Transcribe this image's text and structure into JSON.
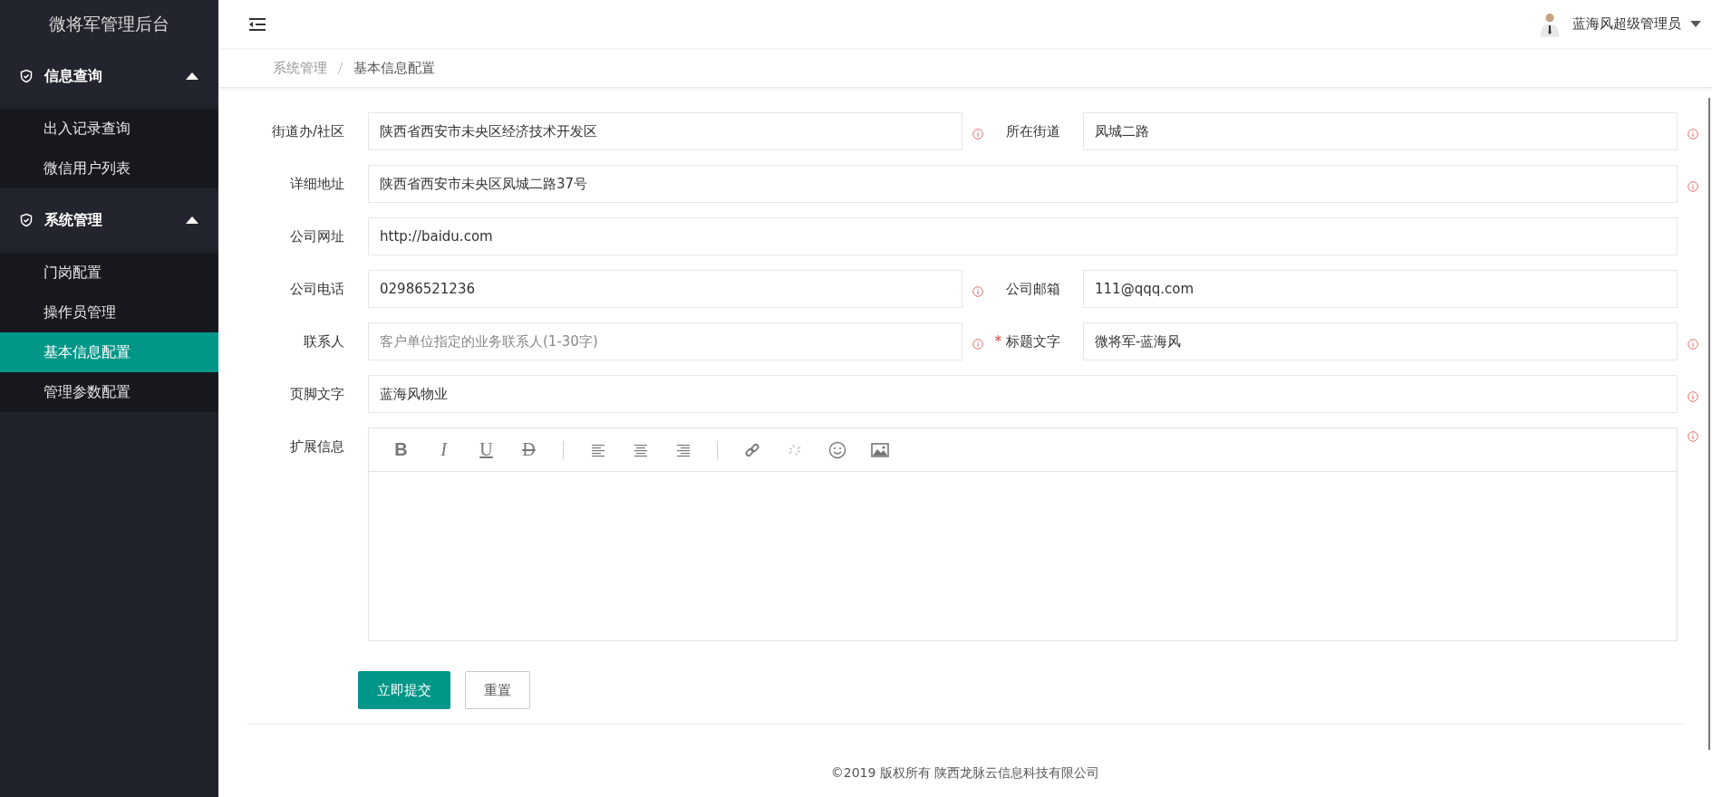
{
  "sidebar": {
    "title": "微将军管理后台",
    "groups": [
      {
        "label": "信息查询",
        "expanded": true,
        "items": [
          {
            "label": "出入记录查询",
            "selected": false
          },
          {
            "label": "微信用户列表",
            "selected": false
          }
        ]
      },
      {
        "label": "系统管理",
        "expanded": true,
        "items": [
          {
            "label": "门岗配置",
            "selected": false
          },
          {
            "label": "操作员管理",
            "selected": false
          },
          {
            "label": "基本信息配置",
            "selected": true
          },
          {
            "label": "管理参数配置",
            "selected": false
          }
        ]
      }
    ]
  },
  "header": {
    "user": "蓝海风超级管理员"
  },
  "breadcrumb": [
    "系统管理",
    "基本信息配置"
  ],
  "form": {
    "required_mark": "*",
    "rows": [
      {
        "fields": [
          {
            "label": "街道办/社区",
            "value": "陕西省西安市未央区经济技术开发区",
            "info": true,
            "required": false
          },
          {
            "label": "所在街道",
            "value": "凤城二路",
            "info": true,
            "required": false
          }
        ]
      },
      {
        "fields": [
          {
            "label": "详细地址",
            "value": "陕西省西安市未央区凤城二路37号",
            "info": true,
            "required": false
          }
        ]
      },
      {
        "fields": [
          {
            "label": "公司网址",
            "value": "http://baidu.com",
            "required": false
          }
        ]
      },
      {
        "fields": [
          {
            "label": "公司电话",
            "value": "02986521236",
            "info": true,
            "required": false
          },
          {
            "label": "公司邮箱",
            "value": "111@qqq.com",
            "required": false
          }
        ]
      },
      {
        "fields": [
          {
            "label": "联系人",
            "placeholder": "客户单位指定的业务联系人(1-30字)",
            "info": true,
            "required": false
          },
          {
            "label": "标题文字",
            "value": "微将军-蓝海风",
            "info": true,
            "required": true
          }
        ]
      },
      {
        "fields": [
          {
            "label": "页脚文字",
            "value": "蓝海风物业",
            "info": true,
            "required": false
          }
        ]
      }
    ],
    "editor": {
      "label": "扩展信息",
      "info": true,
      "tools": [
        {
          "kind": "bold",
          "text": "B",
          "disabled": false
        },
        {
          "kind": "italic",
          "text": "I",
          "disabled": false
        },
        {
          "kind": "underline",
          "text": "U",
          "disabled": false
        },
        {
          "kind": "strike",
          "text": "D",
          "disabled": false
        },
        {
          "kind": "separator"
        },
        {
          "kind": "align-left",
          "disabled": false
        },
        {
          "kind": "align-center",
          "disabled": false
        },
        {
          "kind": "align-right",
          "disabled": false
        },
        {
          "kind": "separator"
        },
        {
          "kind": "link",
          "disabled": false
        },
        {
          "kind": "unlink",
          "disabled": true
        },
        {
          "kind": "emoji",
          "disabled": false
        },
        {
          "kind": "image",
          "disabled": false
        }
      ]
    },
    "buttons": [
      {
        "label": "立即提交",
        "primary": true
      },
      {
        "label": "重置",
        "primary": false
      }
    ]
  },
  "footer": "©2019 版权所有 陕西龙脉云信息科技有限公司"
}
